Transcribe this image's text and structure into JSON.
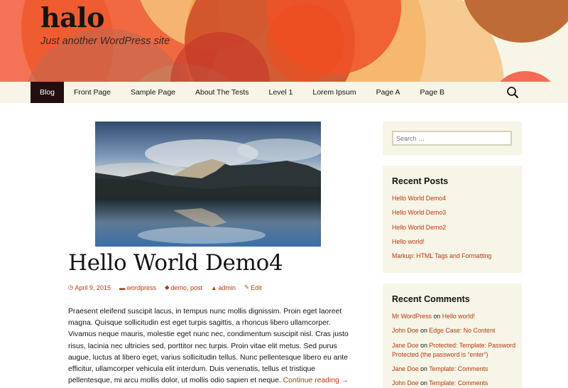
{
  "site": {
    "title": "halo",
    "description": "Just another WordPress site"
  },
  "nav": {
    "items": [
      {
        "label": "Blog",
        "active": true
      },
      {
        "label": "Front Page"
      },
      {
        "label": "Sample Page"
      },
      {
        "label": "About The Tests"
      },
      {
        "label": "Level 1"
      },
      {
        "label": "Lorem Ipsum"
      },
      {
        "label": "Page A"
      },
      {
        "label": "Page B"
      }
    ],
    "search_icon": "search-icon"
  },
  "post": {
    "image_alt": "Mountain lake reflection under cloudy sky",
    "title": "Hello World Demo4",
    "meta": {
      "date": "April 9, 2015",
      "category": "wordpress",
      "tags": "demo, post",
      "author": "admin",
      "edit": "Edit"
    },
    "content": "Praesent eleifend suscipit lacus, in tempus nunc mollis dignissim. Proin eget laoreet magna. Quisque sollicitudin est eget turpis sagittis, a rhoncus libero ullamcorper. Vivamus neque mauris, molestie eget nunc nec, condimentum suscipit nisl. Cras justo risus, lacinia nec ultricies sed, porttitor nec turpis. Proin vitae elit metus. Sed purus augue, luctus at libero eget, varius sollicitudin tellus. Nunc pellentesque libero eu ante efficitur, ullamcorper vehicula elit interdum. Duis venenatis, tellus et tristique pellentesque, mi arcu mollis dolor, ut mollis odio sapien et neque. ",
    "continue_reading": "Continue reading →"
  },
  "sidebar": {
    "search_placeholder": "Search …",
    "recent_posts": {
      "title": "Recent Posts",
      "items": [
        "Hello World Demo4",
        "Hello World Demo3",
        "Hello World Demo2",
        "Hello world!",
        "Markup: HTML Tags and Formatting"
      ]
    },
    "recent_comments": {
      "title": "Recent Comments",
      "connector": "on",
      "items": [
        {
          "author": "Mr WordPress",
          "post": "Hello world!"
        },
        {
          "author": "John Doe",
          "post": "Edge Case: No Content"
        },
        {
          "author": "Jane Doe",
          "post": "Protected: Template: Password Protected (the password is “enter”)"
        },
        {
          "author": "Jane Doe",
          "post": "Template: Comments"
        },
        {
          "author": "John Doe",
          "post": "Template: Comments"
        }
      ]
    }
  },
  "colors": {
    "accent": "#bc360a",
    "nav_bg": "#f7f5e7",
    "nav_active": "#220e10",
    "widget_bg": "#f7f5e7"
  }
}
